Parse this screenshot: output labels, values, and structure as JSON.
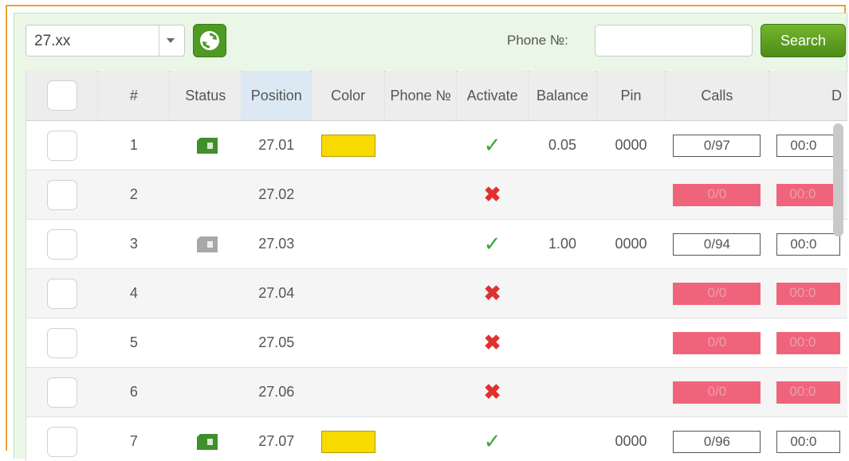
{
  "toolbar": {
    "group_value": "27.xx",
    "phone_label": "Phone №:",
    "phone_value": "",
    "search_label": "Search"
  },
  "table": {
    "columns": [
      "",
      "#",
      "Status",
      "Position",
      "Color",
      "Phone №",
      "Activate",
      "Balance",
      "Pin",
      "Calls",
      "D"
    ],
    "rows": [
      {
        "num": "1",
        "status": "sim-active",
        "position": "27.01",
        "color": "#f7da00",
        "phone": "",
        "activated": true,
        "balance": "0.05",
        "pin": "0000",
        "calls": "0/97",
        "duration": "00:0",
        "calls_state": "normal"
      },
      {
        "num": "2",
        "status": "",
        "position": "27.02",
        "color": "",
        "phone": "",
        "activated": false,
        "balance": "",
        "pin": "",
        "calls": "0/0",
        "duration": "00:0",
        "calls_state": "empty"
      },
      {
        "num": "3",
        "status": "sim-inactive",
        "position": "27.03",
        "color": "",
        "phone": "",
        "activated": true,
        "balance": "1.00",
        "pin": "0000",
        "calls": "0/94",
        "duration": "00:0",
        "calls_state": "normal"
      },
      {
        "num": "4",
        "status": "",
        "position": "27.04",
        "color": "",
        "phone": "",
        "activated": false,
        "balance": "",
        "pin": "",
        "calls": "0/0",
        "duration": "00:0",
        "calls_state": "empty"
      },
      {
        "num": "5",
        "status": "",
        "position": "27.05",
        "color": "",
        "phone": "",
        "activated": false,
        "balance": "",
        "pin": "",
        "calls": "0/0",
        "duration": "00:0",
        "calls_state": "empty"
      },
      {
        "num": "6",
        "status": "",
        "position": "27.06",
        "color": "",
        "phone": "",
        "activated": false,
        "balance": "",
        "pin": "",
        "calls": "0/0",
        "duration": "00:0",
        "calls_state": "empty"
      },
      {
        "num": "7",
        "status": "sim-active",
        "position": "27.07",
        "color": "#f7da00",
        "phone": "",
        "activated": true,
        "balance": "",
        "pin": "0000",
        "calls": "0/96",
        "duration": "00:0",
        "calls_state": "normal"
      }
    ]
  },
  "colors": {
    "accent": "#4e9a23",
    "empty_calls": "#f0647b",
    "highlight": "#f7da00",
    "ok": "#3aa53a",
    "bad": "#e03030"
  },
  "icons": {
    "activated": "check-icon",
    "not_activated": "cross-icon",
    "status": "sim-card-icon",
    "refresh": "refresh-icon",
    "dropdown": "chevron-down-icon"
  }
}
